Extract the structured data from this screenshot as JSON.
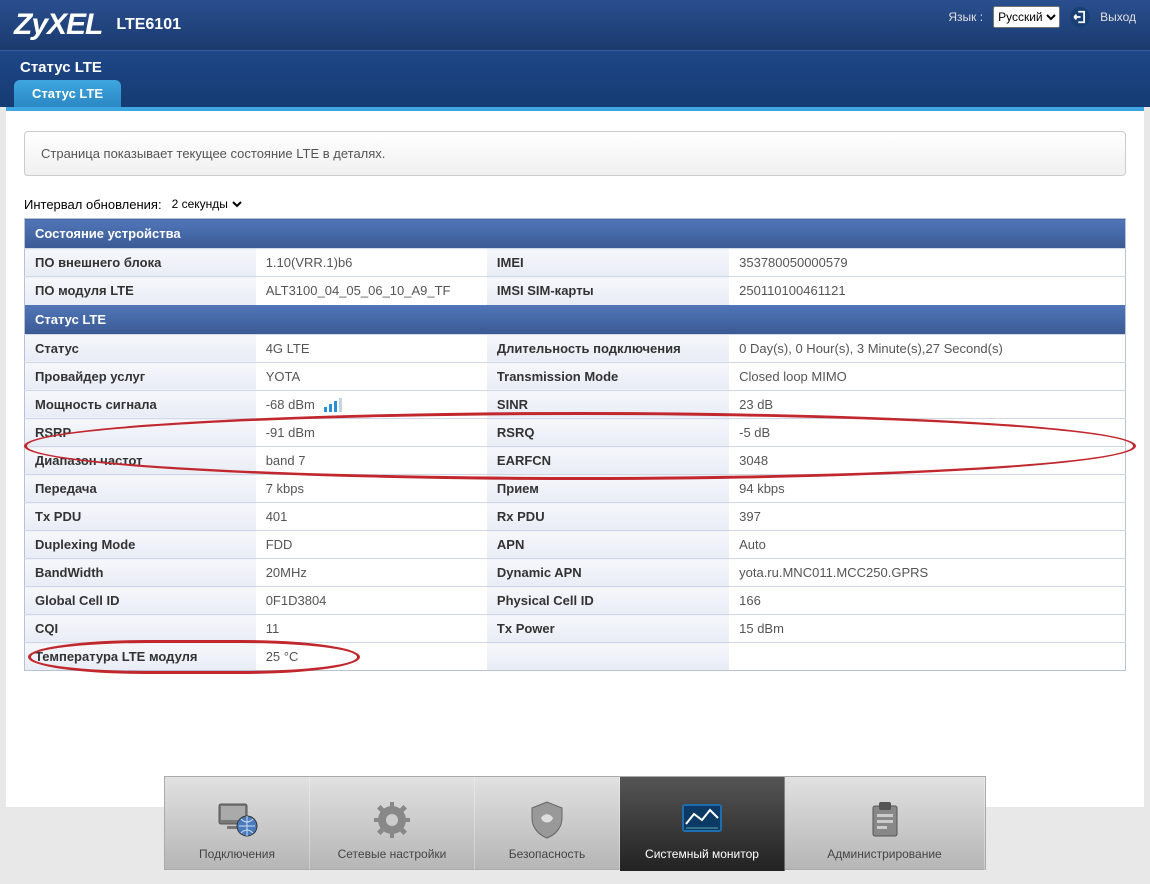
{
  "brand": "ZyXEL",
  "model": "LTE6101",
  "header": {
    "lang_label": "Язык :",
    "lang_value": "Русский",
    "exit_label": "Выход"
  },
  "page": {
    "title": "Статус LTE",
    "tab_label": "Статус LTE",
    "description": "Страница показывает текущее состояние LTE в деталях.",
    "refresh_label": "Интервал обновления:",
    "refresh_value": "2 секунды"
  },
  "sections": {
    "device_state_header": "Состояние устройства",
    "lte_status_header": "Статус LTE"
  },
  "device": {
    "ext_fw_label": "ПО внешнего блока",
    "ext_fw_value": "1.10(VRR.1)b6",
    "imei_label": "IMEI",
    "imei_value": "353780050000579",
    "lte_fw_label": "ПО модуля LTE",
    "lte_fw_value": "ALT3100_04_05_06_10_A9_TF",
    "imsi_label": "IMSI SIM-карты",
    "imsi_value": "250110100461121"
  },
  "lte": {
    "status_label": "Статус",
    "status_value": "4G LTE",
    "duration_label": "Длительность подключения",
    "duration_value": "0 Day(s), 0 Hour(s), 3 Minute(s),27 Second(s)",
    "provider_label": "Провайдер услуг",
    "provider_value": "YOTA",
    "txmode_label": "Transmission Mode",
    "txmode_value": "Closed loop MIMO",
    "signal_label": "Мощность сигнала",
    "signal_value": "-68 dBm",
    "sinr_label": "SINR",
    "sinr_value": "23 dB",
    "rsrp_label": "RSRP",
    "rsrp_value": "-91 dBm",
    "rsrq_label": "RSRQ",
    "rsrq_value": "-5 dB",
    "band_label": "Диапазон частот",
    "band_value": "band 7",
    "earfcn_label": "EARFCN",
    "earfcn_value": "3048",
    "tx_label": "Передача",
    "tx_value": "7 kbps",
    "rx_label": "Прием",
    "rx_value": "94 kbps",
    "txpdu_label": "Tx PDU",
    "txpdu_value": "401",
    "rxpdu_label": "Rx PDU",
    "rxpdu_value": "397",
    "duplex_label": "Duplexing Mode",
    "duplex_value": "FDD",
    "apn_label": "APN",
    "apn_value": "Auto",
    "bw_label": "BandWidth",
    "bw_value": "20MHz",
    "dynapn_label": "Dynamic APN",
    "dynapn_value": "yota.ru.MNC011.MCC250.GPRS",
    "gcid_label": "Global Cell ID",
    "gcid_value": "0F1D3804",
    "pcid_label": "Physical Cell ID",
    "pcid_value": "166",
    "cqi_label": "CQI",
    "cqi_value": "11",
    "txpower_label": "Tx Power",
    "txpower_value": "15 dBm",
    "temp_label": "Температура LTE модуля",
    "temp_value": "25 °C"
  },
  "nav": {
    "connections": "Подключения",
    "network": "Сетевые настройки",
    "security": "Безопасность",
    "monitor": "Системный монитор",
    "admin": "Администрирование"
  }
}
